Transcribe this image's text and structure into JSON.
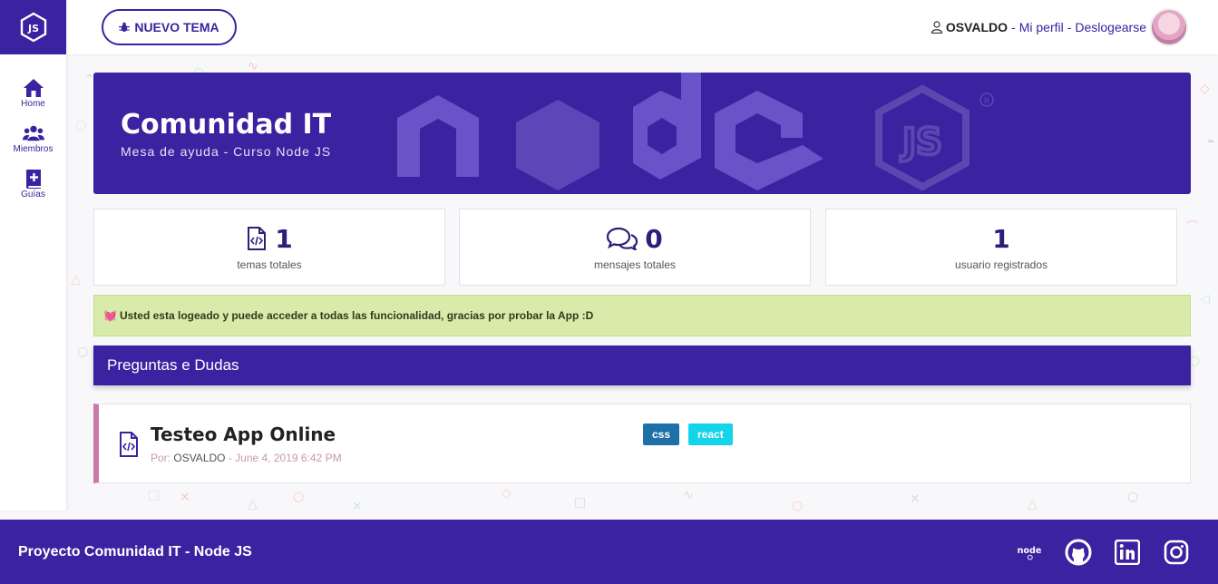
{
  "sidebar": {
    "logo": "nodejs-logo",
    "items": [
      {
        "label": "Home",
        "icon": "home-icon"
      },
      {
        "label": "Miembros",
        "icon": "users-icon"
      },
      {
        "label": "Guías",
        "icon": "book-plus-icon"
      }
    ]
  },
  "header": {
    "new_topic_label": "NUEVO TEMA",
    "user_name": "OSVALDO",
    "separator": "-",
    "profile_link": "Mi perfil",
    "logout_link": "Deslogearse"
  },
  "hero": {
    "title": "Comunidad IT",
    "subtitle": "Mesa de ayuda - Curso Node JS"
  },
  "stats": [
    {
      "value": "1",
      "label": "temas totales",
      "icon": "file-code-icon"
    },
    {
      "value": "0",
      "label": "mensajes totales",
      "icon": "comments-icon"
    },
    {
      "value": "1",
      "label": "usuario registrados",
      "icon": ""
    }
  ],
  "alert": {
    "icon": "💓",
    "text": "Usted esta logeado y puede acceder a todas las funcionalidad, gracias por probar la App :D"
  },
  "section": {
    "title": "Preguntas e Dudas"
  },
  "topic": {
    "title": "Testeo App Online",
    "by_label": "Por:",
    "author": "OSVALDO",
    "date": "- June 4, 2019 6:42 PM",
    "tags": [
      {
        "label": "css",
        "color": "#1f6fa8"
      },
      {
        "label": "react",
        "color": "#14d4ea"
      }
    ]
  },
  "footer": {
    "text": "Proyecto Comunidad IT - Node JS",
    "icons": [
      "node-icon",
      "github-icon",
      "linkedin-icon",
      "instagram-icon"
    ]
  },
  "colors": {
    "primary": "#3b22a0",
    "alert_bg": "#d9ebab",
    "topic_accent": "#c97aa9"
  }
}
